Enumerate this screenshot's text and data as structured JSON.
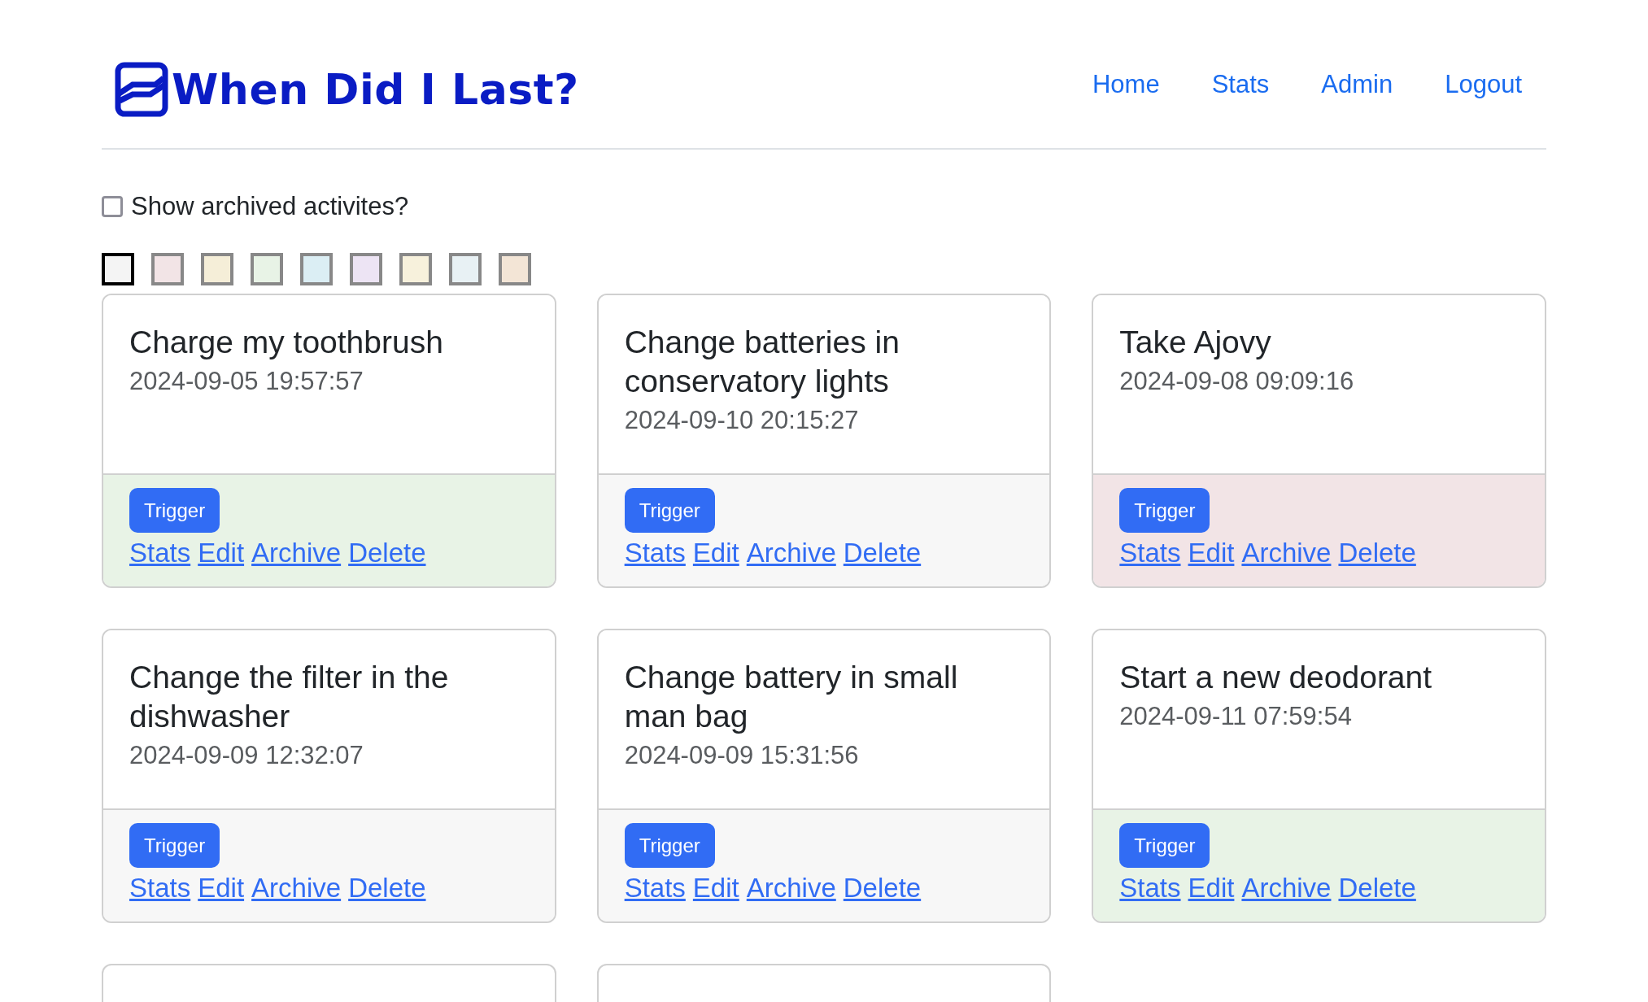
{
  "brand": {
    "title": "When Did I Last?"
  },
  "nav": [
    {
      "label": "Home"
    },
    {
      "label": "Stats"
    },
    {
      "label": "Admin"
    },
    {
      "label": "Logout"
    }
  ],
  "show_archived": {
    "label": "Show archived activites?",
    "checked": false
  },
  "color_filters": [
    {
      "color": "#f4f4f4",
      "selected": true
    },
    {
      "color": "#f2e4e6",
      "selected": false
    },
    {
      "color": "#f5eed8",
      "selected": false
    },
    {
      "color": "#e8f3e6",
      "selected": false
    },
    {
      "color": "#dbeef4",
      "selected": false
    },
    {
      "color": "#ede4f4",
      "selected": false
    },
    {
      "color": "#f7f1dc",
      "selected": false
    },
    {
      "color": "#e8f1f4",
      "selected": false
    },
    {
      "color": "#f3e5d6",
      "selected": false
    }
  ],
  "cards": [
    {
      "kind": "activity",
      "title": "Charge my toothbrush",
      "date": "2024-09-05 19:57:57",
      "color": "#e8f3e6",
      "button": "Trigger",
      "links": [
        "Stats",
        "Edit",
        "Archive",
        "Delete"
      ]
    },
    {
      "kind": "activity",
      "title": "Change batteries in conservatory lights",
      "date": "2024-09-10 20:15:27",
      "color": "#f7f7f7",
      "button": "Trigger",
      "links": [
        "Stats",
        "Edit",
        "Archive",
        "Delete"
      ]
    },
    {
      "kind": "activity",
      "title": "Take Ajovy",
      "date": "2024-09-08 09:09:16",
      "color": "#f2e4e6",
      "button": "Trigger",
      "links": [
        "Stats",
        "Edit",
        "Archive",
        "Delete"
      ]
    },
    {
      "kind": "activity",
      "title": "Change the filter in the dishwasher",
      "date": "2024-09-09 12:32:07",
      "color": "#f7f7f7",
      "button": "Trigger",
      "links": [
        "Stats",
        "Edit",
        "Archive",
        "Delete"
      ]
    },
    {
      "kind": "activity",
      "title": "Change battery in small man bag",
      "date": "2024-09-09 15:31:56",
      "color": "#f7f7f7",
      "button": "Trigger",
      "links": [
        "Stats",
        "Edit",
        "Archive",
        "Delete"
      ]
    },
    {
      "kind": "activity",
      "title": "Start a new deodorant",
      "date": "2024-09-11 07:59:54",
      "color": "#e8f3e6",
      "button": "Trigger",
      "links": [
        "Stats",
        "Edit",
        "Archive",
        "Delete"
      ]
    },
    {
      "kind": "cut_off"
    },
    {
      "kind": "cut_off"
    }
  ]
}
